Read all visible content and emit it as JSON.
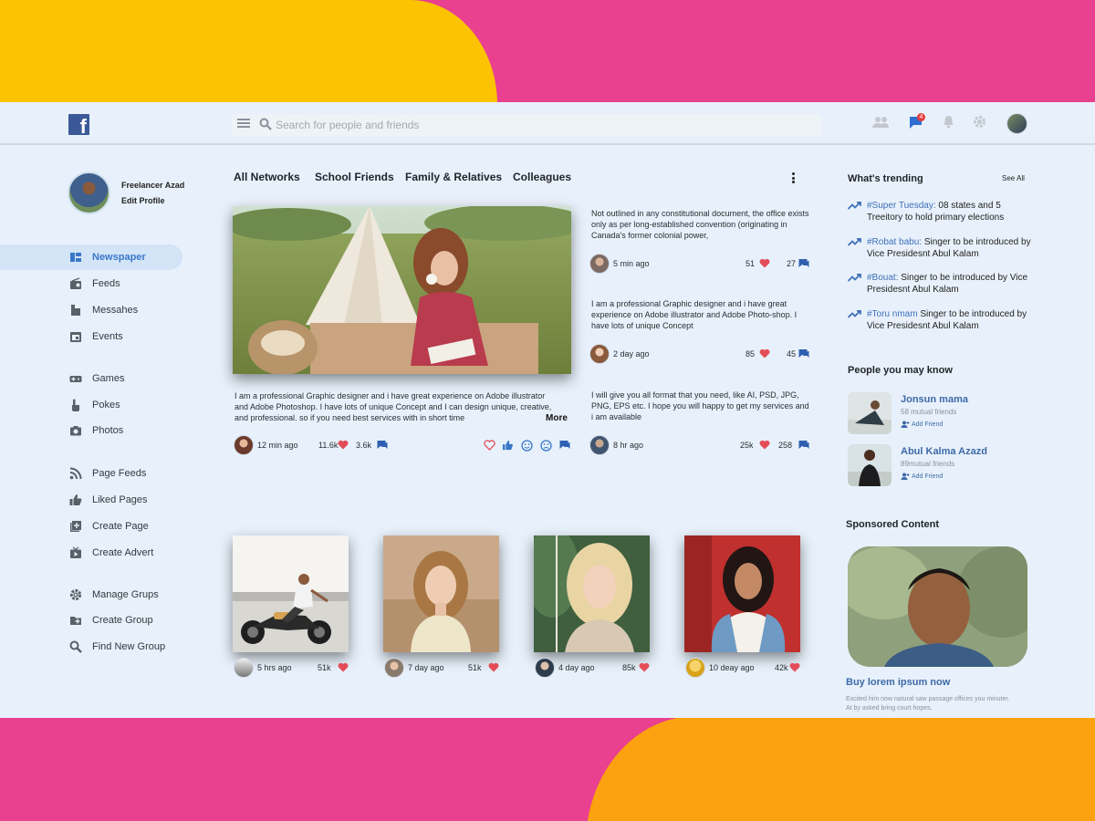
{
  "colors": {
    "accent": "#3978c9",
    "brand": "#3b5998",
    "heart": "#e34d58",
    "notification": "#e53b3b"
  },
  "header": {
    "search_placeholder": "Search for people and friends",
    "messages_badge": "4"
  },
  "profile": {
    "name": "Freelancer Azad",
    "edit_label": "Edit Profile"
  },
  "sidebar": {
    "items": [
      {
        "label": "Newspaper",
        "icon": "newspaper-icon",
        "active": true
      },
      {
        "label": "Feeds",
        "icon": "radio-icon"
      },
      {
        "label": "Messahes",
        "icon": "messages-icon"
      },
      {
        "label": "Events",
        "icon": "calendar-icon"
      },
      {
        "label": "Games",
        "icon": "gamepad-icon"
      },
      {
        "label": "Pokes",
        "icon": "poke-icon"
      },
      {
        "label": "Photos",
        "icon": "camera-icon"
      },
      {
        "label": "Page Feeds",
        "icon": "rss-icon"
      },
      {
        "label": "Liked Pages",
        "icon": "thumbs-up-icon"
      },
      {
        "label": "Create Page",
        "icon": "add-page-icon"
      },
      {
        "label": "Create Advert",
        "icon": "tv-icon"
      },
      {
        "label": "Manage Grups",
        "icon": "gear-icon"
      },
      {
        "label": "Create Group",
        "icon": "add-folder-icon"
      },
      {
        "label": "Find New Group",
        "icon": "search-icon"
      }
    ]
  },
  "tabs": [
    "All Networks",
    "School Friends",
    "Family & Relatives",
    "Colleagues"
  ],
  "main_post": {
    "text": "I am a professional Graphic designer and i have great experience on Adobe illustrator and Adobe Photoshop. I have lots of unique Concept and I can design unique, creative, and professional. so if you need best services with in short time",
    "more_label": "More",
    "time": "12 min  ago",
    "likes": "11.6k",
    "comments": "3.6k"
  },
  "side_posts": [
    {
      "text": "Not outlined in any constitutional document, the office exists only as per long-established convention (originating in Canada's former colonial power,",
      "time": "5 min  ago",
      "likes": "51",
      "comments": "27"
    },
    {
      "text": "I am a professional Graphic designer and i have great experience on Adobe illustrator and Adobe Photo-shop. I have lots of unique Concept",
      "time": "2 day  ago",
      "likes": "85",
      "comments": "45"
    },
    {
      "text": "I will give you all format that you need, like AI, PSD, JPG, PNG, EPS etc. I hope you will happy to get my services and i am available",
      "time": "8 hr ago",
      "likes": "25k",
      "comments": "258"
    }
  ],
  "photo_posts": [
    {
      "time": "5 hrs  ago",
      "likes": "51k"
    },
    {
      "time": "7 day  ago",
      "likes": "51k"
    },
    {
      "time": "4  day  ago",
      "likes": "85k"
    },
    {
      "time": "10 deay  ago",
      "likes": "42k"
    }
  ],
  "trending": {
    "title": "What's trending",
    "see_all": "See All",
    "items": [
      {
        "tag": "#Super Tuesday:",
        "text": " 08 states and 5 Treeitory to hold primary elections"
      },
      {
        "tag": "#Robat babu:",
        "text": " Singer to be introduced by Vice Presidesnt Abul Kalam"
      },
      {
        "tag": "#Bouat:",
        "text": " Singer to be introduced by Vice Presidesnt Abul Kalam"
      },
      {
        "tag": "#Toru nmam",
        "text": " Singer to be introduced by Vice Presidesnt Abul Kalam"
      }
    ]
  },
  "people": {
    "title": "People you may know",
    "items": [
      {
        "name": "Jonsun mama",
        "mutual": "58 mutual friends",
        "add_label": "Add Friend"
      },
      {
        "name": "Abul Kalma Azazd",
        "mutual": "89mutual friends",
        "add_label": "Add Friend"
      }
    ]
  },
  "sponsored": {
    "title": "Sponsored Content",
    "headline": "Buy lorem ipsum now",
    "description": "Excited him now natural saw passage offices you minuter. At by asked bring court hopes."
  }
}
